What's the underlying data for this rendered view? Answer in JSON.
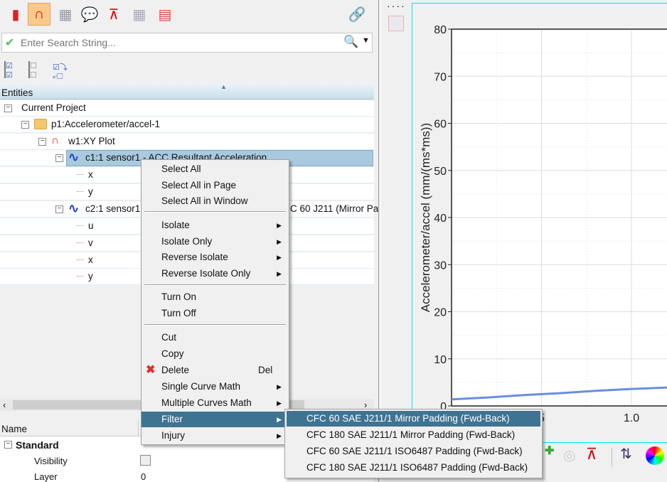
{
  "toolbar": {
    "icons": [
      "bar-chart-icon",
      "xy-plot-icon",
      "table-grid-icon",
      "note-icon",
      "curve-icon",
      "grid-icon",
      "report-icon",
      "link-icon"
    ],
    "active": "xy-plot-icon"
  },
  "search": {
    "placeholder": "Enter Search String...",
    "value": ""
  },
  "tree": {
    "header": "Entities",
    "rows": [
      {
        "label": "Current Project"
      },
      {
        "label": "p1:Accelerometer/accel-1"
      },
      {
        "label": "w1:XY Plot"
      },
      {
        "label": "c1:1 sensor1 - ACC Resultant Acceleration",
        "selected": true
      },
      {
        "label": "x"
      },
      {
        "label": "y"
      },
      {
        "label": "c2:1 sensor1",
        "trailing": "C 60 J211 (Mirror Pa"
      },
      {
        "label": "u"
      },
      {
        "label": "v"
      },
      {
        "label": "x"
      },
      {
        "label": "y"
      }
    ]
  },
  "properties": {
    "col_name": "Name",
    "group": "Standard",
    "items": [
      {
        "name": "Visibility",
        "value": ""
      },
      {
        "name": "Layer",
        "value": "0"
      }
    ]
  },
  "context_menu": {
    "items": [
      "Select All",
      "Select All in Page",
      "Select All in Window",
      "Isolate",
      "Isolate Only",
      "Reverse Isolate",
      "Reverse Isolate Only",
      "Turn On",
      "Turn Off",
      "Cut",
      "Copy",
      "Delete",
      "Single Curve Math",
      "Multiple Curves Math",
      "Filter",
      "Injury"
    ],
    "delete_shortcut": "Del",
    "highlighted": "Filter"
  },
  "filter_submenu": {
    "items": [
      "CFC 60 SAE J211/1 Mirror Padding (Fwd-Back)",
      "CFC 180 SAE J211/1 Mirror Padding (Fwd-Back)",
      "CFC 60 SAE J211/1 ISO6487 Padding (Fwd-Back)",
      "CFC 180 SAE J211/1 ISO6487 Padding (Fwd-Back)"
    ],
    "highlighted": 0
  },
  "chart_data": {
    "type": "line",
    "ylabel": "Accelerometer/accel (mm/(ms*ms))",
    "xlabel": "",
    "yticks": [
      "0",
      "10",
      "20",
      "30",
      "40",
      "50",
      "60",
      "70",
      "80"
    ],
    "xticks": [
      "5",
      "1.0"
    ],
    "ylim": [
      0,
      80
    ],
    "grid": true,
    "series": [
      {
        "color": "#6a8ee0",
        "x": [
          0,
          0.2,
          0.4,
          0.6,
          0.8,
          1.0,
          1.2
        ],
        "y": [
          1.4,
          1.8,
          2.3,
          2.7,
          3.2,
          3.6,
          3.9
        ]
      }
    ]
  },
  "colors": {
    "selection": "#3f7392",
    "plot_border": "#00e5ee",
    "curve": "#6a8ee0"
  }
}
